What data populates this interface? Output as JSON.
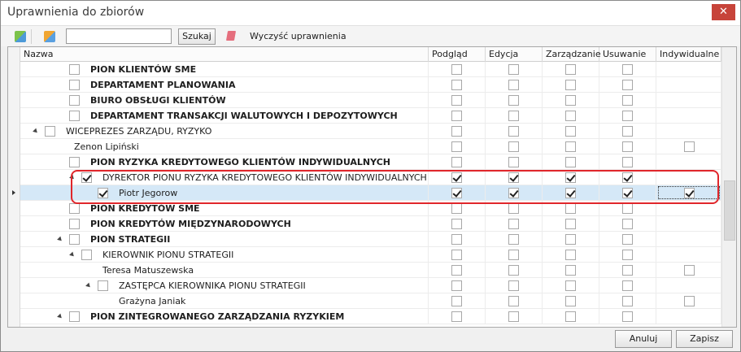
{
  "window": {
    "title": "Uprawnienia do zbiorów",
    "close_glyph": "✕"
  },
  "toolbar": {
    "icons": [
      "grant-permissions-icon",
      "refresh-permissions-icon"
    ],
    "search_value": "",
    "search_placeholder": "",
    "search_label": "Szukaj",
    "clear_icon": "eraser-icon",
    "clear_label": "Wyczyść uprawnienia"
  },
  "columns": [
    "Nazwa",
    "Podgląd",
    "Edycja",
    "Zarządzanie",
    "Usuwanie",
    "Indywidualne"
  ],
  "rows": [
    {
      "level": 2,
      "expander": false,
      "name": "PION KLIENTÓW SME",
      "bold": true,
      "checked": false,
      "perms": [
        false,
        false,
        false,
        false
      ],
      "indyw": null
    },
    {
      "level": 2,
      "expander": false,
      "name": "DEPARTAMENT PLANOWANIA",
      "bold": true,
      "checked": false,
      "perms": [
        false,
        false,
        false,
        false
      ],
      "indyw": null
    },
    {
      "level": 2,
      "expander": false,
      "name": "BIURO OBSŁUGI KLIENTÓW",
      "bold": true,
      "checked": false,
      "perms": [
        false,
        false,
        false,
        false
      ],
      "indyw": null
    },
    {
      "level": 2,
      "expander": false,
      "name": "DEPARTAMENT TRANSAKCJI WALUTOWYCH I DEPOZYTOWYCH",
      "bold": true,
      "checked": false,
      "perms": [
        false,
        false,
        false,
        false
      ],
      "indyw": null
    },
    {
      "level": 1,
      "expander": true,
      "name": "WICEPREZES ZARZĄDU, RYZYKO",
      "bold": false,
      "checked": false,
      "perms": [
        false,
        false,
        false,
        false
      ],
      "indyw": null
    },
    {
      "level": 2,
      "expander": false,
      "name": "Zenon Lipiński",
      "bold": false,
      "checked": null,
      "perms": [
        false,
        false,
        false,
        false
      ],
      "indyw": false
    },
    {
      "level": 2,
      "expander": false,
      "name": "PION RYZYKA KREDYTOWEGO KLIENTÓW INDYWIDUALNYCH",
      "bold": true,
      "checked": false,
      "perms": [
        false,
        false,
        false,
        false
      ],
      "indyw": null
    },
    {
      "level": 3,
      "expander": true,
      "name": "DYREKTOR PIONU RYZYKA KREDYTOWEGO KLIENTÓW INDYWIDUALNYCH",
      "bold": false,
      "checked": true,
      "perms": [
        true,
        true,
        true,
        true
      ],
      "indyw": null
    },
    {
      "level": 4,
      "expander": false,
      "name": "Piotr Jegorow",
      "bold": false,
      "checked": true,
      "perms": [
        true,
        true,
        true,
        true
      ],
      "indyw": true,
      "selected": true
    },
    {
      "level": 2,
      "expander": false,
      "name": "PION KREDYTÓW SME",
      "bold": true,
      "checked": false,
      "perms": [
        false,
        false,
        false,
        false
      ],
      "indyw": null
    },
    {
      "level": 2,
      "expander": false,
      "name": "PION KREDYTÓW MIĘDZYNARODOWYCH",
      "bold": true,
      "checked": false,
      "perms": [
        false,
        false,
        false,
        false
      ],
      "indyw": null
    },
    {
      "level": 2,
      "expander": true,
      "name": "PION STRATEGII",
      "bold": true,
      "checked": false,
      "perms": [
        false,
        false,
        false,
        false
      ],
      "indyw": null
    },
    {
      "level": 3,
      "expander": true,
      "name": "KIEROWNIK PIONU STRATEGII",
      "bold": false,
      "checked": false,
      "perms": [
        false,
        false,
        false,
        false
      ],
      "indyw": null
    },
    {
      "level": 4,
      "expander": false,
      "name": "Teresa Matuszewska",
      "bold": false,
      "checked": null,
      "perms": [
        false,
        false,
        false,
        false
      ],
      "indyw": false
    },
    {
      "level": 4,
      "expander": true,
      "name": "ZASTĘPCA KIEROWNIKA PIONU STRATEGII",
      "bold": false,
      "checked": false,
      "perms": [
        false,
        false,
        false,
        false
      ],
      "indyw": null
    },
    {
      "level": 5,
      "expander": false,
      "name": "Grażyna Janiak",
      "bold": false,
      "checked": null,
      "perms": [
        false,
        false,
        false,
        false
      ],
      "indyw": false
    },
    {
      "level": 2,
      "expander": true,
      "name": "PION ZINTEGROWANEGO ZARZĄDZANIA RYZYKIEM",
      "bold": true,
      "checked": false,
      "perms": [
        false,
        false,
        false,
        false
      ],
      "indyw": null
    }
  ],
  "footer": {
    "cancel_label": "Anuluj",
    "save_label": "Zapisz"
  }
}
